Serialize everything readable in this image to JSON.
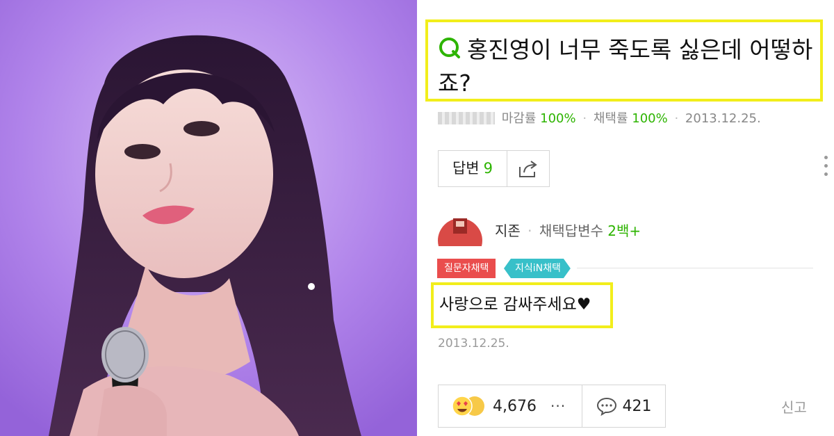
{
  "question": {
    "icon": "q-icon",
    "title_line1": "홍진영이 너무 죽도록 싫은데 어떻하",
    "title_line2": "죠?",
    "accent_color": "#2db400",
    "highlight_color": "#f2ee1b"
  },
  "meta": {
    "close_rate_label": "마감률",
    "close_rate": "100%",
    "adopt_rate_label": "채택률",
    "adopt_rate": "100%",
    "date": "2013.12.25."
  },
  "actions": {
    "answers_label": "답변",
    "answers_count": "9",
    "share_icon": "share-icon",
    "more_icon": "kebab-menu-icon"
  },
  "answer": {
    "author_name": "지존",
    "author_stat_label": "채택답변수",
    "author_stat_value": "2백+",
    "tags": [
      "질문자채택",
      "지식iN채택"
    ],
    "text": "사랑으로 감싸주세요♥",
    "date": "2013.12.25.",
    "reaction_count": "4,676",
    "more_label": "···",
    "comment_count": "421",
    "report_label": "신고"
  }
}
